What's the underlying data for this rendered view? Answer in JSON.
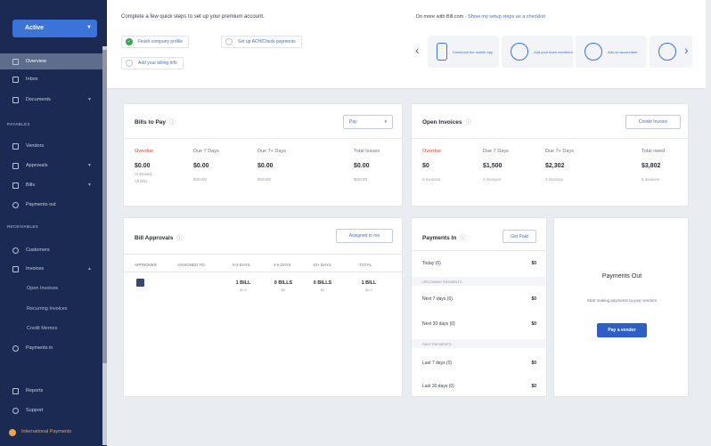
{
  "sidebar": {
    "account_label": "Active",
    "items_top": [
      {
        "label": "Overview"
      },
      {
        "label": "Inbox"
      },
      {
        "label": "Documents"
      }
    ],
    "section_payables": "PAYABLES",
    "items_payables": [
      {
        "label": "Vendors"
      },
      {
        "label": "Approvals"
      },
      {
        "label": "Bills"
      },
      {
        "label": "Payments out"
      }
    ],
    "section_receivables": "RECEIVABLES",
    "items_receivables": [
      {
        "label": "Customers"
      },
      {
        "label": "Invoices"
      }
    ],
    "items_invoice_sub": [
      {
        "label": "Open Invoices"
      },
      {
        "label": "Recurring Invoices"
      },
      {
        "label": "Credit Memos"
      }
    ],
    "payments_in": "Payments in",
    "reports": "Reports",
    "support": "Support",
    "international": "International Payments"
  },
  "top": {
    "quick_title": "Complete a few quick steps to set up your premium account.",
    "steps": [
      {
        "label": "Finish company profile"
      },
      {
        "label": "Set up ACH/Check payments"
      },
      {
        "label": "Add your billing info"
      }
    ],
    "more_title": "Do more with Bill.com",
    "more_link": "Show my setup steps as a checklist",
    "tiles": [
      {
        "label": "Download the mobile app"
      },
      {
        "label": "Add your team members"
      },
      {
        "label": "Add an accountant"
      },
      {
        "label": ""
      }
    ]
  },
  "bills_to_pay": {
    "title": "Bills to Pay",
    "dropdown": "Pay",
    "stats": [
      {
        "label": "Overdue",
        "value": "$0.00",
        "sub1": "Unlimited",
        "sub2": "All Bills"
      },
      {
        "label": "Due 7 Days",
        "value": "$0.00",
        "sub1": "$0/0.00"
      },
      {
        "label": "Due 7+ Days",
        "value": "$0.00",
        "sub1": "$0/0.00"
      },
      {
        "label": "Total Issues",
        "value": "$0.00",
        "sub1": "$0/0.00"
      }
    ]
  },
  "open_invoices": {
    "title": "Open Invoices",
    "button": "Create Invoice",
    "stats": [
      {
        "label": "Overdue",
        "value": "$0",
        "sub1": "0 invoices"
      },
      {
        "label": "Due 7 Days",
        "value": "$1,500",
        "sub1": "2 invoices"
      },
      {
        "label": "Due 7+ Days",
        "value": "$2,302",
        "sub1": "3 invoices"
      },
      {
        "label": "Total owed",
        "value": "$3,802",
        "sub1": "5 invoices"
      }
    ]
  },
  "bill_approvals": {
    "title": "Bill Approvals",
    "button": "Assigned to me",
    "headers": [
      "APPROVER",
      "ASSIGNED TO",
      "0-3 DAYS",
      "4-6 DAYS",
      "10+ DAYS",
      "TOTAL"
    ],
    "cells": [
      {
        "main": "1 BILL",
        "sub": "$0.0"
      },
      {
        "main": "0 BILLS",
        "sub": "$0"
      },
      {
        "main": "0 BILLS",
        "sub": "$0"
      },
      {
        "main": "1 BILL",
        "sub": "$0.0"
      }
    ]
  },
  "payments_in_card": {
    "title": "Payments In",
    "button": "Get Paid",
    "today_label": "Today (0)",
    "today_value": "$0",
    "section_upcoming": "UPCOMING PAYMENTS",
    "upcoming": [
      {
        "label": "Next 7 days (0)",
        "value": "$0"
      },
      {
        "label": "Next 30 days (0)",
        "value": "$0"
      }
    ],
    "section_past": "PAST PAYMENTS",
    "past": [
      {
        "label": "Last 7 days (0)",
        "value": "$0"
      },
      {
        "label": "Last 30 days (0)",
        "value": "$0"
      }
    ]
  },
  "payments_out_card": {
    "title": "Payments Out",
    "subtitle": "Start making payments to your vendors",
    "button": "Pay a vendor"
  },
  "colors": {
    "sidebar_bg": "#1b2a52",
    "accent": "#3c73d8",
    "overdue_red": "#d9482b",
    "success_green": "#34a853",
    "intl_orange": "#f0a24a"
  }
}
